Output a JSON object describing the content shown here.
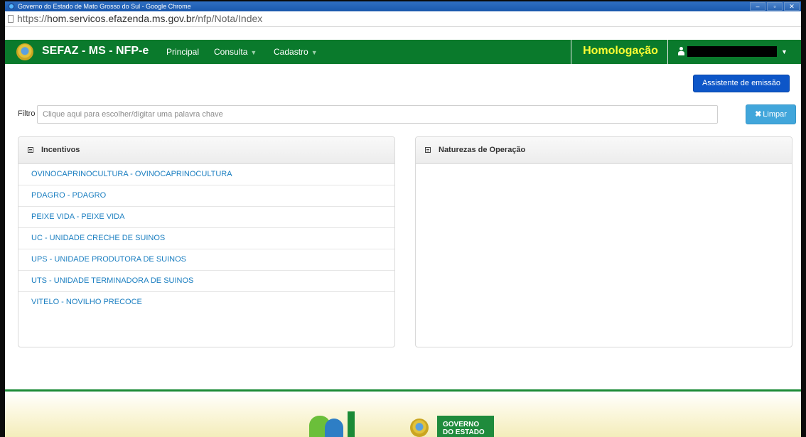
{
  "browser": {
    "window_title": "Governo do Estado de Mato Grosso do Sul - Google Chrome",
    "window_buttons": [
      "–",
      "▫",
      "✕"
    ],
    "url_host_prefix": "https://",
    "url_host": "hom.servicos.efazenda.ms.gov.br",
    "url_path": "/nfp/Nota/Index"
  },
  "navbar": {
    "brand": "SEFAZ - MS - NFP-e",
    "items": [
      {
        "label": "Principal",
        "has_dropdown": false
      },
      {
        "label": "Consulta",
        "has_dropdown": true
      },
      {
        "label": "Cadastro",
        "has_dropdown": true
      }
    ],
    "environment": "Homologação",
    "user_name": "",
    "colors": {
      "background": "#0a7a2c",
      "environment_text": "#ffff33"
    }
  },
  "actions": {
    "assistant_button": "Assistente de emissão"
  },
  "filter": {
    "label": "Filtro",
    "placeholder": "Clique aqui para escolher/digitar uma palavra chave",
    "value": "",
    "clear_button": "Limpar",
    "clear_icon": "✖"
  },
  "panels": {
    "incentivos": {
      "title": "Incentivos",
      "items": [
        "OVINOCAPRINOCULTURA - OVINOCAPRINOCULTURA",
        "PDAGRO - PDAGRO",
        "PEIXE VIDA - PEIXE VIDA",
        "UC - UNIDADE CRECHE DE SUINOS",
        "UPS - UNIDADE PRODUTORA DE SUINOS",
        "UTS - UNIDADE TERMINADORA DE SUINOS",
        "VITELO - NOVILHO PRECOCE"
      ]
    },
    "naturezas": {
      "title": "Naturezas de Operação",
      "items": []
    }
  },
  "footer": {
    "gov_line1": "GOVERNO",
    "gov_line2": "DO ESTADO"
  }
}
